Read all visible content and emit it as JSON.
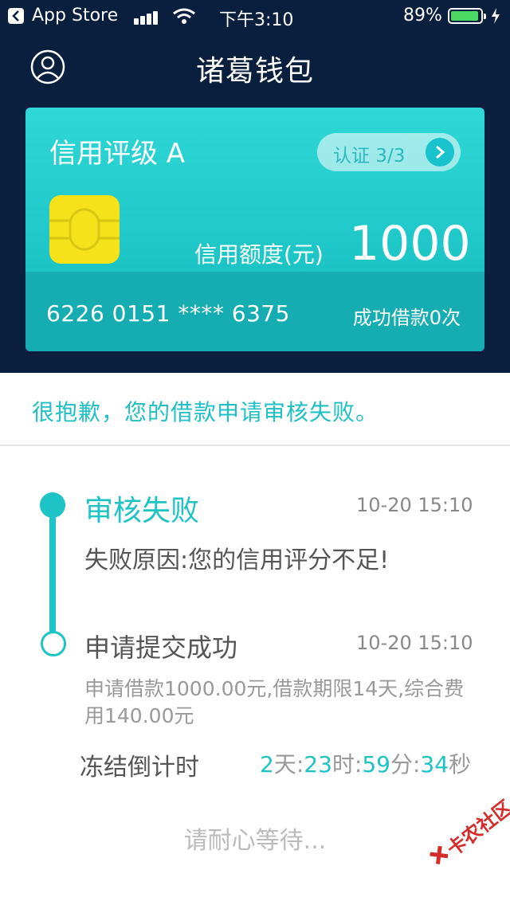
{
  "status_bar": {
    "back_app": "App Store",
    "time": "下午3:10",
    "battery": "89%",
    "battery_level": 0.89
  },
  "nav": {
    "title": "诸葛钱包"
  },
  "card": {
    "grade": "信用评级 A",
    "cert": "认证 3/3",
    "limit_label": "信用额度(元)",
    "limit_value": "1000",
    "card_number": "6226 0151 **** 6375",
    "success_count": "成功借款0次"
  },
  "message": "很抱歉，您的借款申请审核失败。",
  "timeline": {
    "items": [
      {
        "status": "审核失败",
        "time": "10-20 15:10",
        "detail": "失败原因:您的信用评分不足!"
      },
      {
        "status": "申请提交成功",
        "time": "10-20 15:10",
        "detail": "申请借款1000.00元,借款期限14天,综合费用140.00元"
      }
    ]
  },
  "countdown": {
    "label": "冻结倒计时",
    "days": "2",
    "days_unit": "天:",
    "hours": "23",
    "hours_unit": "时:",
    "minutes": "59",
    "minutes_unit": "分:",
    "seconds": "34",
    "seconds_unit": "秒"
  },
  "wait_text": "请耐心等待...",
  "watermark": "卡农社区",
  "colors": {
    "navy": "#0a1f3d",
    "accent": "#1ec3c6",
    "chip": "#f5e21a",
    "battery": "#4cd964"
  }
}
